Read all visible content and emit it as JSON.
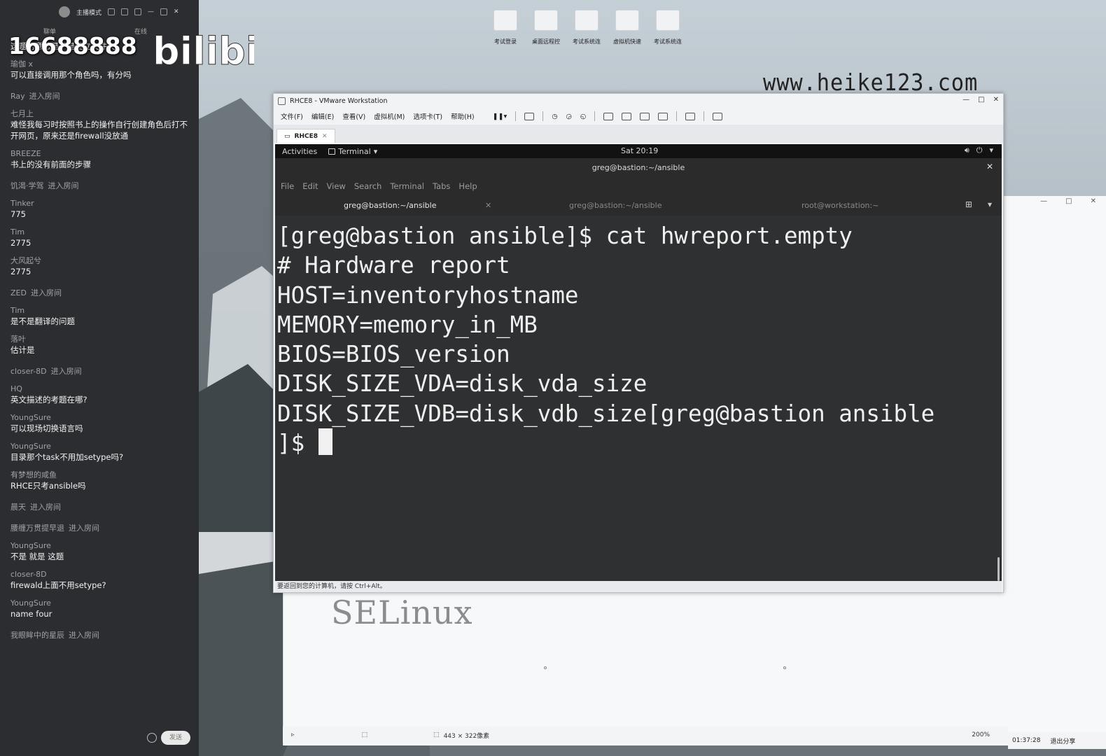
{
  "chat": {
    "host_mode": "主播模式",
    "tab_left": "聊单",
    "tab_right": "在线",
    "messages": [
      {
        "user": "",
        "text": "这题的意思是不是建立文件夹",
        "kind": "msg"
      },
      {
        "user": "瑜伽 x",
        "text": "可以直接调用那个角色吗，有分吗",
        "kind": "msg"
      },
      {
        "user": "Ray",
        "action": "进入房间",
        "kind": "join"
      },
      {
        "user": "七月上",
        "text": "难怪我每习时按照书上的操作自行创建角色后打不开网页，原来还是firewall没放通",
        "kind": "msg"
      },
      {
        "user": "BREEZE",
        "text": "书上的没有前面的步骤",
        "kind": "msg"
      },
      {
        "user": "饥渴·学驾",
        "action": "进入房间",
        "kind": "join"
      },
      {
        "user": "Tinker",
        "text": "775",
        "kind": "msg"
      },
      {
        "user": "Tim",
        "text": "2775",
        "kind": "msg"
      },
      {
        "user": "大风起兮",
        "text": "2775",
        "kind": "msg"
      },
      {
        "user": "ZED",
        "action": "进入房间",
        "kind": "join"
      },
      {
        "user": "Tim",
        "text": "是不是翻译的问题",
        "kind": "msg"
      },
      {
        "user": "落叶",
        "text": "估计是",
        "kind": "msg"
      },
      {
        "user": "closer-8D",
        "action": "进入房间",
        "kind": "join"
      },
      {
        "user": "HQ",
        "text": "英文描述的考题在哪?",
        "kind": "msg"
      },
      {
        "user": "YoungSure",
        "text": "可以现场切换语言吗",
        "kind": "msg"
      },
      {
        "user": "YoungSure",
        "text": "目录那个task不用加setype吗?",
        "kind": "msg"
      },
      {
        "user": "有梦想的咸鱼",
        "text": "RHCE只考ansible吗",
        "kind": "msg"
      },
      {
        "user": "晨天",
        "action": "进入房间",
        "kind": "join"
      },
      {
        "user": "腰缠万贯提早退",
        "action": "进入房间",
        "kind": "join"
      },
      {
        "user": "YoungSure",
        "text": "不是 就是 这题",
        "kind": "msg"
      },
      {
        "user": "closer-8D",
        "text": "firewald上面不用setype?",
        "kind": "msg"
      },
      {
        "user": "YoungSure",
        "text": "name four",
        "kind": "msg"
      },
      {
        "user": "我眼眸中的星辰",
        "action": "进入房间",
        "kind": "join"
      }
    ],
    "send_label": "发送"
  },
  "watermark": {
    "room_number": "16688888",
    "brand": "bilibili",
    "site": "www.heike123.com"
  },
  "desktop_icons": [
    "考试登录",
    "桌面远程控",
    "考试系统连",
    "虚拟机快速",
    "考试系统连"
  ],
  "vmware": {
    "title": "RHCE8 - VMware Workstation",
    "menu": [
      "文件(F)",
      "编辑(E)",
      "查看(V)",
      "虚拟机(M)",
      "选项卡(T)",
      "帮助(H)"
    ],
    "tab_label": "RHCE8",
    "hint": "要返回到您的计算机，请按 Ctrl+Alt。"
  },
  "gnome": {
    "activities": "Activities",
    "app": "Terminal",
    "clock": "Sat 20:19"
  },
  "terminal": {
    "title": "greg@bastion:~/ansible",
    "menu": [
      "File",
      "Edit",
      "View",
      "Search",
      "Terminal",
      "Tabs",
      "Help"
    ],
    "tabs": [
      "greg@bastion:~/ansible",
      "greg@bastion:~/ansible",
      "root@workstation:~"
    ],
    "lines": [
      "[greg@bastion ansible]$ cat hwreport.empty",
      "# Hardware report",
      "HOST=inventoryhostname",
      "MEMORY=memory_in_MB",
      "BIOS=BIOS_version",
      "DISK_SIZE_VDA=disk_vda_size",
      "DISK_SIZE_VDB=disk_vdb_size[greg@bastion ansible",
      "]$ "
    ]
  },
  "doc": {
    "heading": "SELinux"
  },
  "statusbar": {
    "dimensions": "443 × 322像素",
    "zoom": "200%"
  },
  "tray": {
    "time": "01:37:28",
    "exit_share": "退出分享"
  }
}
